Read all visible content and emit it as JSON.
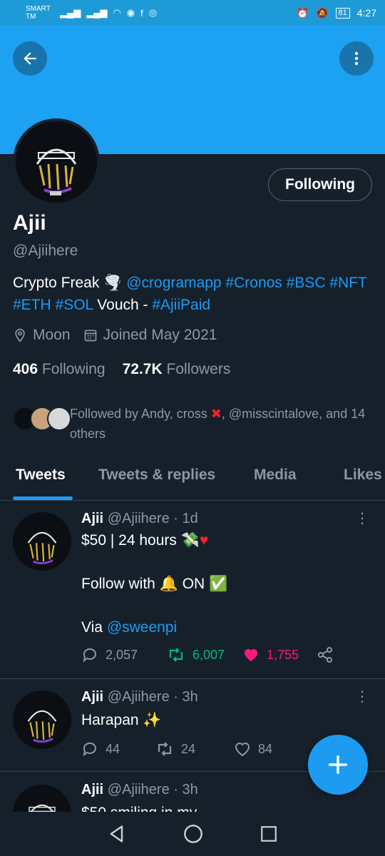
{
  "status_bar": {
    "carrier": "SMART TM",
    "battery": "81",
    "time": "4:27"
  },
  "profile": {
    "name": "Ajii",
    "handle": "@Ajiihere",
    "follow_button": "Following",
    "bio": {
      "text1": "Crypto Freak ",
      "link1": "@crogramapp",
      "link2": "#Cronos",
      "link3": "#BSC",
      "link4": "#NFT",
      "link5": "#ETH",
      "link6": "#SOL",
      "text2": "Vouch - ",
      "link7": "#AjiiPaid"
    },
    "location": "Moon",
    "joined": "Joined May 2021",
    "following_count": "406",
    "following_label": "Following",
    "followers_count": "72.7K",
    "followers_label": "Followers",
    "followed_by_prefix": "Followed by Andy, cross ",
    "followed_by_suffix": ", @misscintalove, and 14 others"
  },
  "tabs": [
    {
      "label": "Tweets",
      "active": true
    },
    {
      "label": "Tweets & replies",
      "active": false
    },
    {
      "label": "Media",
      "active": false
    },
    {
      "label": "Likes",
      "active": false
    }
  ],
  "tweets": [
    {
      "name": "Ajii",
      "meta": "@Ajiihere · 1d",
      "line1": "$50 | 24 hours",
      "line2": "Follow with",
      "line2b": "ON",
      "line3": "Via ",
      "line3_link": "@sweenpi",
      "replies": "2,057",
      "retweets": "6,007",
      "likes": "1,755"
    },
    {
      "name": "Ajii",
      "meta": "@Ajiihere · 3h",
      "line1": "Harapan",
      "replies": "44",
      "retweets": "24",
      "likes": "84"
    },
    {
      "name": "Ajii",
      "meta": "@Ajiihere · 3h",
      "line1": "$50 smiling in my"
    }
  ],
  "colors": {
    "background": "#15202b",
    "banner": "#1da1f2",
    "accent": "#1d9bf0",
    "retweet": "#00ba7c",
    "like": "#f91880",
    "muted": "#8b98a5"
  }
}
